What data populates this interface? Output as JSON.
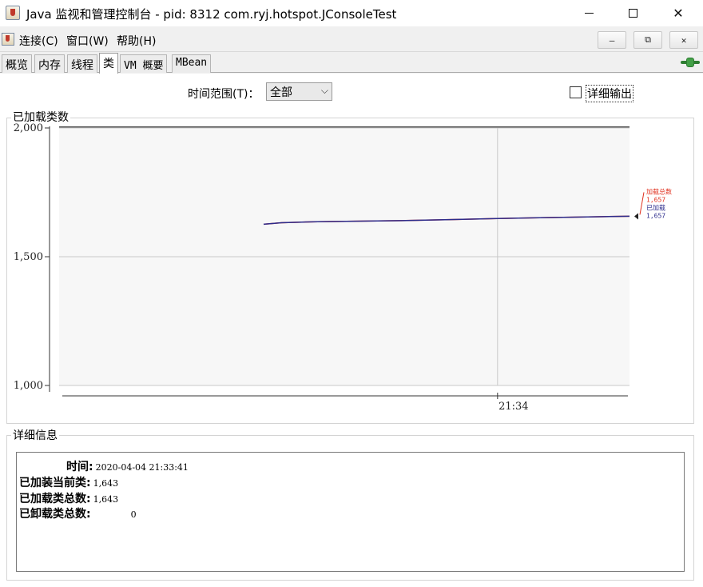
{
  "window": {
    "title": "Java 监视和管理控制台 - pid: 8312 com.ryj.hotspot.JConsoleTest",
    "minimize_glyph": "",
    "close_glyph": "✕"
  },
  "menubar": {
    "items": [
      "连接(C)",
      "窗口(W)",
      "帮助(H)"
    ],
    "mdi_buttons": [
      "–",
      "⧉",
      "✕"
    ]
  },
  "tabs": [
    {
      "label": "概览"
    },
    {
      "label": "内存"
    },
    {
      "label": "线程"
    },
    {
      "label": "类",
      "active": true
    },
    {
      "label": "VM 概要"
    },
    {
      "label": "MBean"
    }
  ],
  "toolbar": {
    "range_label": "时间范围(T)：",
    "range_value": "全部",
    "verbose_label": "详细输出",
    "verbose_checked": false
  },
  "chart_panel": {
    "title": "已加载类数"
  },
  "chart_data": {
    "type": "line",
    "title": "",
    "xlabel": "",
    "ylabel": "",
    "ylim": [
      1000,
      2000
    ],
    "y_ticks": [
      "2,000",
      "1,500",
      "1,000"
    ],
    "y_tick_values": [
      2000,
      1500,
      1000
    ],
    "x_tick_labels": [
      "21:34"
    ],
    "series": [
      {
        "name": "加载总数",
        "color": "#e0301e",
        "value_label": "1,657"
      },
      {
        "name": "已加载",
        "color": "#2c2c8c",
        "value_label": "1,657"
      }
    ],
    "points": [
      {
        "t": "21:33:41",
        "y": 1626
      },
      {
        "t": "21:33:44",
        "y": 1632
      },
      {
        "t": "21:33:50",
        "y": 1636
      },
      {
        "t": "21:33:56",
        "y": 1638
      },
      {
        "t": "21:34:04",
        "y": 1640
      },
      {
        "t": "21:34:12",
        "y": 1644
      },
      {
        "t": "21:34:20",
        "y": 1648
      },
      {
        "t": "21:34:28",
        "y": 1652
      },
      {
        "t": "21:34:36",
        "y": 1655
      },
      {
        "t": "21:34:42",
        "y": 1657
      }
    ]
  },
  "details_panel": {
    "title": "详细信息",
    "rows": [
      {
        "key": "时间:",
        "value": "2020-04-04 21:33:41"
      },
      {
        "key": "已加装当前类:",
        "value": "1,643"
      },
      {
        "key": "已加载类总数:",
        "value": "1,643"
      },
      {
        "key": "已卸载类总数:",
        "value": "0"
      }
    ]
  }
}
